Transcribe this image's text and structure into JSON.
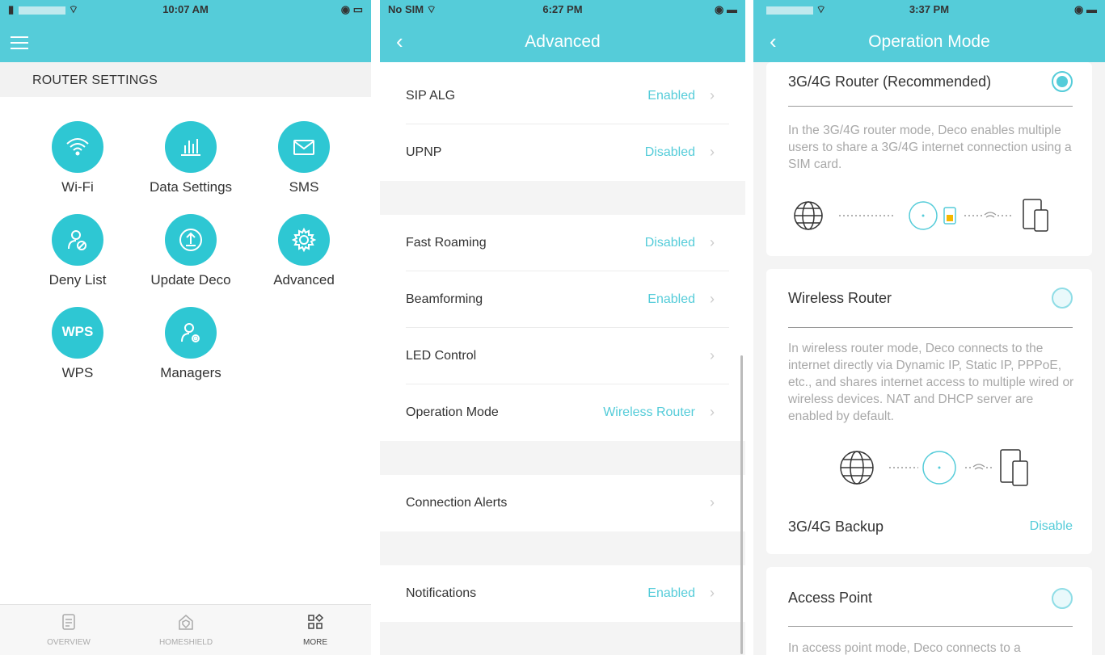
{
  "screen1": {
    "status": {
      "carrier": "",
      "time": "10:07 AM"
    },
    "section_header": "ROUTER SETTINGS",
    "tiles": [
      {
        "label": "Wi-Fi",
        "icon": "wifi-icon"
      },
      {
        "label": "Data Settings",
        "icon": "bar-chart-icon"
      },
      {
        "label": "SMS",
        "icon": "envelope-icon"
      },
      {
        "label": "Deny List",
        "icon": "user-block-icon"
      },
      {
        "label": "Update Deco",
        "icon": "upload-icon"
      },
      {
        "label": "Advanced",
        "icon": "gear-icon"
      },
      {
        "label": "WPS",
        "icon_text": "WPS"
      },
      {
        "label": "Managers",
        "icon": "user-gear-icon"
      }
    ],
    "tabs": [
      {
        "label": "OVERVIEW",
        "icon": "document-icon"
      },
      {
        "label": "HOMESHIELD",
        "icon": "home-shield-icon"
      },
      {
        "label": "MORE",
        "icon": "grid-icon"
      }
    ]
  },
  "screen2": {
    "status": {
      "carrier": "No SIM",
      "time": "6:27 PM"
    },
    "title": "Advanced",
    "rows": [
      {
        "label": "SIP ALG",
        "value": "Enabled"
      },
      {
        "label": "UPNP",
        "value": "Disabled"
      },
      {
        "label": "Fast Roaming",
        "value": "Disabled"
      },
      {
        "label": "Beamforming",
        "value": "Enabled"
      },
      {
        "label": "LED Control",
        "value": ""
      },
      {
        "label": "Operation Mode",
        "value": "Wireless Router"
      },
      {
        "label": "Connection Alerts",
        "value": ""
      },
      {
        "label": "Notifications",
        "value": "Enabled"
      }
    ]
  },
  "screen3": {
    "status": {
      "time": "3:37 PM"
    },
    "title": "Operation Mode",
    "cards": [
      {
        "title": "3G/4G Router (Recommended)",
        "selected": true,
        "desc": "In the 3G/4G router mode, Deco enables multiple users to share a 3G/4G internet connection using a SIM card."
      },
      {
        "title": "Wireless Router",
        "selected": false,
        "desc": "In wireless router mode, Deco connects to the internet directly via Dynamic IP, Static IP, PPPoE, etc., and shares internet access to multiple wired or wireless devices. NAT and DHCP server are enabled by default.",
        "backup_label": "3G/4G Backup",
        "backup_value": "Disable"
      },
      {
        "title": "Access Point",
        "selected": false,
        "desc": "In access point mode, Deco connects to a"
      }
    ]
  },
  "colors": {
    "accent": "#55ccd9",
    "tile": "#2ec7d3",
    "value": "#55ccd9"
  }
}
